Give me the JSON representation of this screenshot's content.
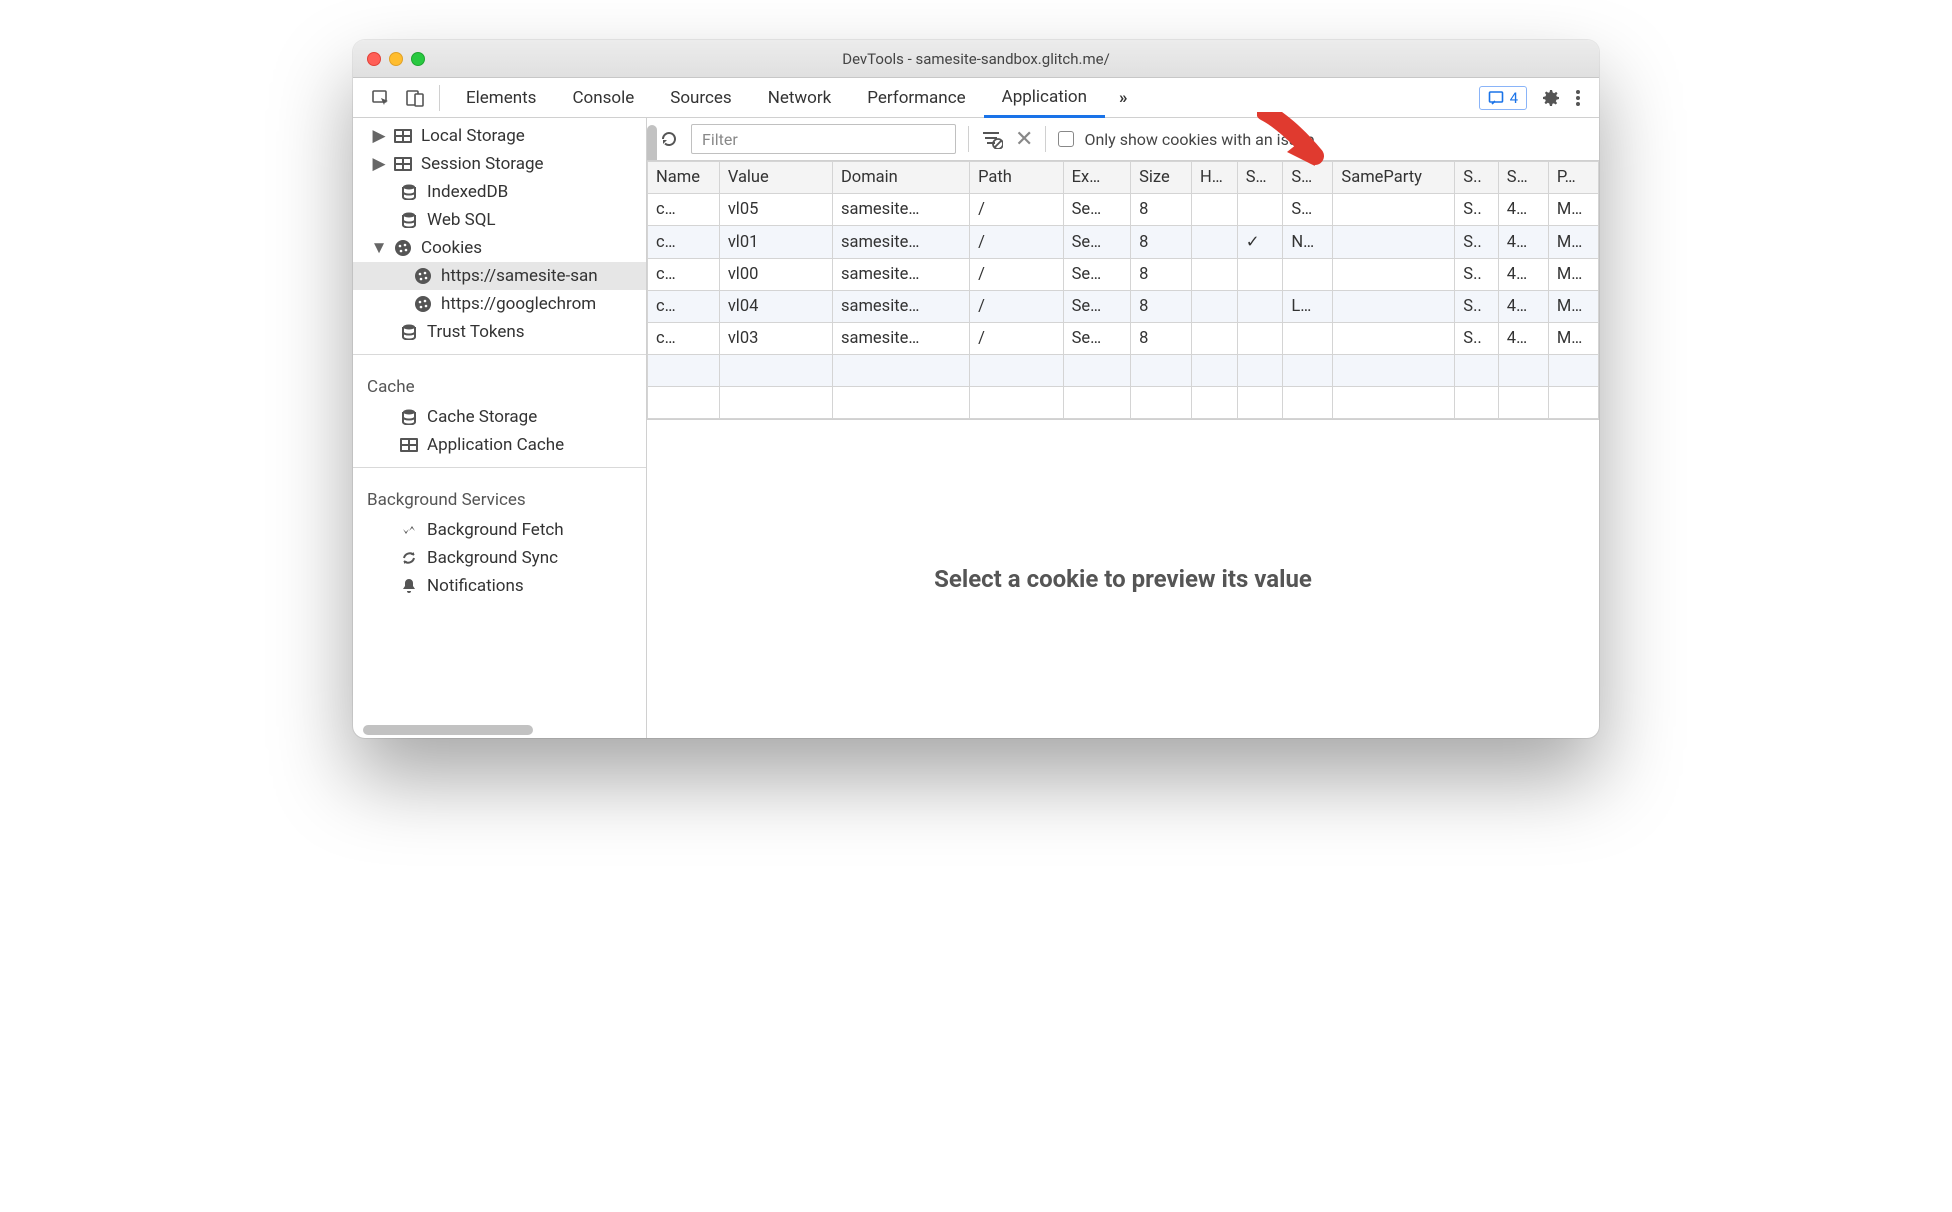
{
  "window": {
    "title": "DevTools - samesite-sandbox.glitch.me/"
  },
  "tabs": {
    "items": [
      "Elements",
      "Console",
      "Sources",
      "Network",
      "Performance",
      "Application"
    ],
    "more": "»",
    "active": "Application",
    "issues_count": "4"
  },
  "sidebar": {
    "storage": {
      "local": "Local Storage",
      "session": "Session Storage",
      "indexed": "IndexedDB",
      "websql": "Web SQL",
      "cookies": "Cookies",
      "cookie_origins": [
        "https://samesite-san",
        "https://googlechrom"
      ],
      "trust": "Trust Tokens"
    },
    "cache": {
      "label": "Cache",
      "cache_storage": "Cache Storage",
      "app_cache": "Application Cache"
    },
    "bg": {
      "label": "Background Services",
      "fetch": "Background Fetch",
      "sync": "Background Sync",
      "notif": "Notifications"
    }
  },
  "toolbar": {
    "filter_placeholder": "Filter",
    "only_issues": "Only show cookies with an issue"
  },
  "table": {
    "columns": [
      "Name",
      "Value",
      "Domain",
      "Path",
      "Ex…",
      "Size",
      "H…",
      "S…",
      "S…",
      "SameParty",
      "S..",
      "S…",
      "P…"
    ],
    "rows": [
      {
        "name": "c…",
        "value": "vl05",
        "domain": "samesite…",
        "path": "/",
        "exp": "Se…",
        "size": "8",
        "h": "",
        "sec": "",
        "ss": "S…",
        "sp": "",
        "sa": "S..",
        "sb": "4…",
        "p": "M…"
      },
      {
        "name": "c…",
        "value": "vl01",
        "domain": "samesite…",
        "path": "/",
        "exp": "Se…",
        "size": "8",
        "h": "",
        "sec": "✓",
        "ss": "N…",
        "sp": "",
        "sa": "S..",
        "sb": "4…",
        "p": "M…"
      },
      {
        "name": "c…",
        "value": "vl00",
        "domain": "samesite…",
        "path": "/",
        "exp": "Se…",
        "size": "8",
        "h": "",
        "sec": "",
        "ss": "",
        "sp": "",
        "sa": "S..",
        "sb": "4…",
        "p": "M…"
      },
      {
        "name": "c…",
        "value": "vl04",
        "domain": "samesite…",
        "path": "/",
        "exp": "Se…",
        "size": "8",
        "h": "",
        "sec": "",
        "ss": "L…",
        "sp": "",
        "sa": "S..",
        "sb": "4…",
        "p": "M…"
      },
      {
        "name": "c…",
        "value": "vl03",
        "domain": "samesite…",
        "path": "/",
        "exp": "Se…",
        "size": "8",
        "h": "",
        "sec": "",
        "ss": "",
        "sp": "",
        "sa": "S..",
        "sb": "4…",
        "p": "M…"
      }
    ]
  },
  "preview": {
    "empty": "Select a cookie to preview its value"
  }
}
